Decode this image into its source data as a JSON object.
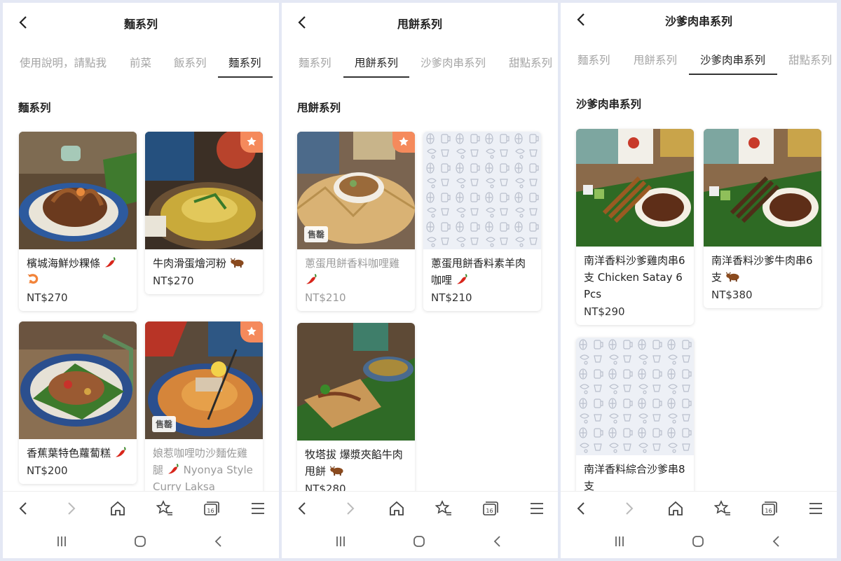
{
  "colors": {
    "badge": "#f58a5c",
    "tab_active": "#222222",
    "tab_inactive": "#a4a4a4",
    "underline": "#333333",
    "background": "#e4e8f4"
  },
  "panels": [
    {
      "title": "麵系列",
      "tabs": [
        {
          "label": "使用說明，請點我",
          "active": false
        },
        {
          "label": "前菜",
          "active": false
        },
        {
          "label": "飯系列",
          "active": false
        },
        {
          "label": "麵系列",
          "active": true
        }
      ],
      "section_title": "麵系列",
      "items": [
        {
          "name": "檳城海鮮炒粿條",
          "icons": [
            "chili-icon",
            "shrimp-icon"
          ],
          "price": "NT$270",
          "badge": "none"
        },
        {
          "name": "牛肉滑蛋燴河粉",
          "icons": [
            "beef-icon"
          ],
          "price": "NT$270",
          "badge": "star"
        },
        {
          "name": "香蕉葉特色蘿蔔糕",
          "icons": [
            "chili-icon"
          ],
          "price": "NT$200",
          "badge": "none"
        },
        {
          "name": "娘惹咖哩叻沙麵佐雞腿",
          "name_tail": "Nyonya Style Curry Laksa",
          "icons": [
            "chili-icon"
          ],
          "price": "",
          "badge": "star",
          "sold_label": "售罄"
        }
      ]
    },
    {
      "title": "甩餅系列",
      "tabs": [
        {
          "label": "麵系列",
          "active": false
        },
        {
          "label": "甩餅系列",
          "active": true
        },
        {
          "label": "沙爹肉串系列",
          "active": false
        },
        {
          "label": "甜點系列",
          "active": false
        }
      ],
      "section_title": "甩餅系列",
      "items": [
        {
          "name": "蔥蛋甩餅香料咖哩雞",
          "icons": [
            "chili-icon"
          ],
          "price": "NT$210",
          "badge": "star",
          "sold_label": "售罄"
        },
        {
          "name": "蔥蛋甩餅香料素羊肉咖哩",
          "icons": [
            "chili-icon"
          ],
          "price": "NT$210",
          "badge": "none"
        },
        {
          "name": "牧塔拔 爆漿夾餡牛肉甩餅",
          "icons": [
            "beef-icon"
          ],
          "price": "NT$280",
          "badge": "none"
        }
      ]
    },
    {
      "title": "沙爹肉串系列",
      "tabs": [
        {
          "label": "麵系列",
          "active": false
        },
        {
          "label": "甩餅系列",
          "active": false
        },
        {
          "label": "沙爹肉串系列",
          "active": true
        },
        {
          "label": "甜點系列",
          "active": false
        }
      ],
      "section_title": "沙爹肉串系列",
      "items": [
        {
          "name": "南洋香料沙爹雞肉串6支 Chicken Satay 6 Pcs",
          "icons": [],
          "price": "NT$290",
          "badge": "none"
        },
        {
          "name": "南洋香料沙爹牛肉串6支",
          "icons": [
            "beef-icon"
          ],
          "price": "NT$380",
          "badge": "none"
        },
        {
          "name": "南洋香料綜合沙爹串8支",
          "icons": [],
          "price": "",
          "badge": "none"
        }
      ]
    }
  ],
  "bottom_nav": [
    "back-icon",
    "forward-icon",
    "home-icon",
    "favorites-icon",
    "tabs-icon",
    "menu-icon"
  ],
  "tabs_count": "16",
  "system_nav": [
    "recents-icon",
    "home-circle-icon",
    "system-back-icon"
  ]
}
